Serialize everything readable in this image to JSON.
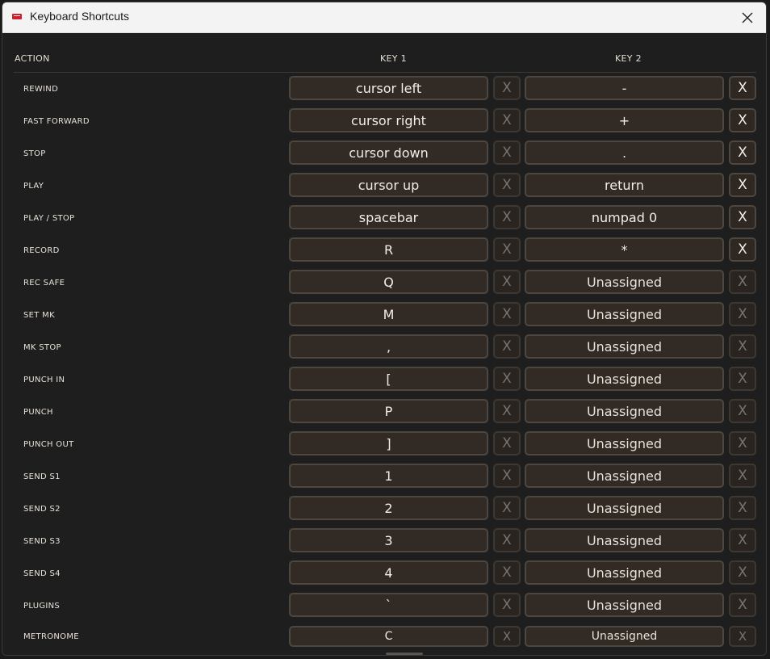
{
  "window": {
    "title": "Keyboard Shortcuts"
  },
  "header": {
    "action": "ACTION",
    "key1": "KEY 1",
    "key2": "KEY 2"
  },
  "clear_label": "X",
  "rows": [
    {
      "action": "REWIND",
      "key1": "cursor left",
      "key2": "-",
      "key2_assigned": true
    },
    {
      "action": "FAST FORWARD",
      "key1": "cursor right",
      "key2": "+",
      "key2_assigned": true
    },
    {
      "action": "STOP",
      "key1": "cursor down",
      "key2": ".",
      "key2_assigned": true
    },
    {
      "action": "PLAY",
      "key1": "cursor up",
      "key2": "return",
      "key2_assigned": true
    },
    {
      "action": "PLAY / STOP",
      "key1": "spacebar",
      "key2": "numpad 0",
      "key2_assigned": true
    },
    {
      "action": "RECORD",
      "key1": "R",
      "key2": "*",
      "key2_assigned": true
    },
    {
      "action": "REC SAFE",
      "key1": "Q",
      "key2": "Unassigned",
      "key2_assigned": false
    },
    {
      "action": "SET MK",
      "key1": "M",
      "key2": "Unassigned",
      "key2_assigned": false
    },
    {
      "action": "MK STOP",
      "key1": ",",
      "key2": "Unassigned",
      "key2_assigned": false
    },
    {
      "action": "PUNCH IN",
      "key1": "[",
      "key2": "Unassigned",
      "key2_assigned": false
    },
    {
      "action": "PUNCH",
      "key1": "P",
      "key2": "Unassigned",
      "key2_assigned": false
    },
    {
      "action": "PUNCH OUT",
      "key1": "]",
      "key2": "Unassigned",
      "key2_assigned": false
    },
    {
      "action": "SEND S1",
      "key1": "1",
      "key2": "Unassigned",
      "key2_assigned": false
    },
    {
      "action": "SEND S2",
      "key1": "2",
      "key2": "Unassigned",
      "key2_assigned": false
    },
    {
      "action": "SEND S3",
      "key1": "3",
      "key2": "Unassigned",
      "key2_assigned": false
    },
    {
      "action": "SEND S4",
      "key1": "4",
      "key2": "Unassigned",
      "key2_assigned": false
    },
    {
      "action": "PLUGINS",
      "key1": "`",
      "key2": "Unassigned",
      "key2_assigned": false
    },
    {
      "action": "METRONOME",
      "key1": "C",
      "key2": "Unassigned",
      "key2_assigned": false
    }
  ]
}
